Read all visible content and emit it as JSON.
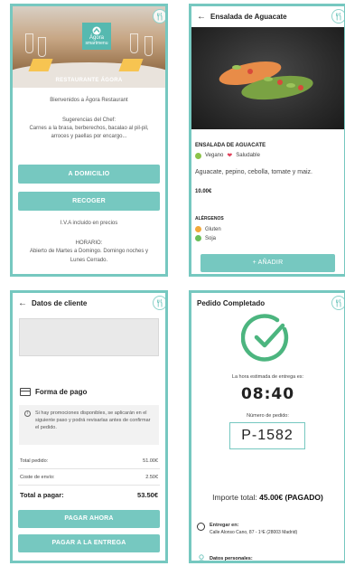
{
  "colors": {
    "accent": "#76c8c0",
    "border": "#76c8c0",
    "vegan": "#8bc34a",
    "healthy": "#e0405a",
    "gluten": "#f2a93b",
    "soy": "#6bbf59"
  },
  "screen1": {
    "logo_line1": "Ágora",
    "logo_line2": "smartmenu",
    "hero_title": "RESTAURANTE ÁGORA",
    "welcome": "Bienvenidos a Ágora Restaurant",
    "suggestions_title": "Sugerencias del Chef:",
    "suggestions_line1": "Carnes a la brasa, berberechos, bacalao al pil-pil,",
    "suggestions_line2": "arroces y paellas por encargo...",
    "btn_delivery": "A DOMICILIO",
    "btn_pickup": "RECOGER",
    "vat_note": "I.V.A incluido en precios",
    "hours_title": "HORARIO:",
    "hours_line1": "Abierto de Martes a Domingo. Domingo noches y",
    "hours_line2": "Lunes Cerrado."
  },
  "screen2": {
    "title": "Ensalada de Aguacate",
    "dish_name": "ENSALADA DE AGUACATE",
    "tag_vegan": "Vegano",
    "tag_healthy": "Saludable",
    "description": "Aguacate, pepino, cebolla, tomate y maiz.",
    "price": "10.00€",
    "allergens_title": "ALÉRGENOS",
    "allergen1": "Gluten",
    "allergen2": "Soja",
    "add_button": "+  AÑADIR"
  },
  "screen3": {
    "title": "Datos de cliente",
    "payment_title": "Forma de pago",
    "info_text": "Si hay promociones disponibles, se aplicarán en el siguiente paso y podrá revisarlas antes de confirmar el pedido.",
    "total_order_label": "Total pedido:",
    "total_order_value": "51.00€",
    "shipping_label": "Coste de envío:",
    "shipping_value": "2.50€",
    "total_pay_label": "Total a pagar:",
    "total_pay_value": "53.50€",
    "btn_pay_now": "PAGAR AHORA",
    "btn_pay_delivery": "PAGAR A LA ENTREGA"
  },
  "screen4": {
    "title": "Pedido Completado",
    "eta_label": "La hora estimada de entrega es:",
    "eta": "08:40",
    "order_label": "Número de pedido:",
    "order_number": "P-1582",
    "import_label": "Importe total: ",
    "import_value": "45.00€ (PAGADO)",
    "deliver_label": "Entregar en:",
    "address": "Calle Alonso Cano, 87 - 1ºE (28003 Madrid)",
    "personal_label": "Datos personales:"
  }
}
